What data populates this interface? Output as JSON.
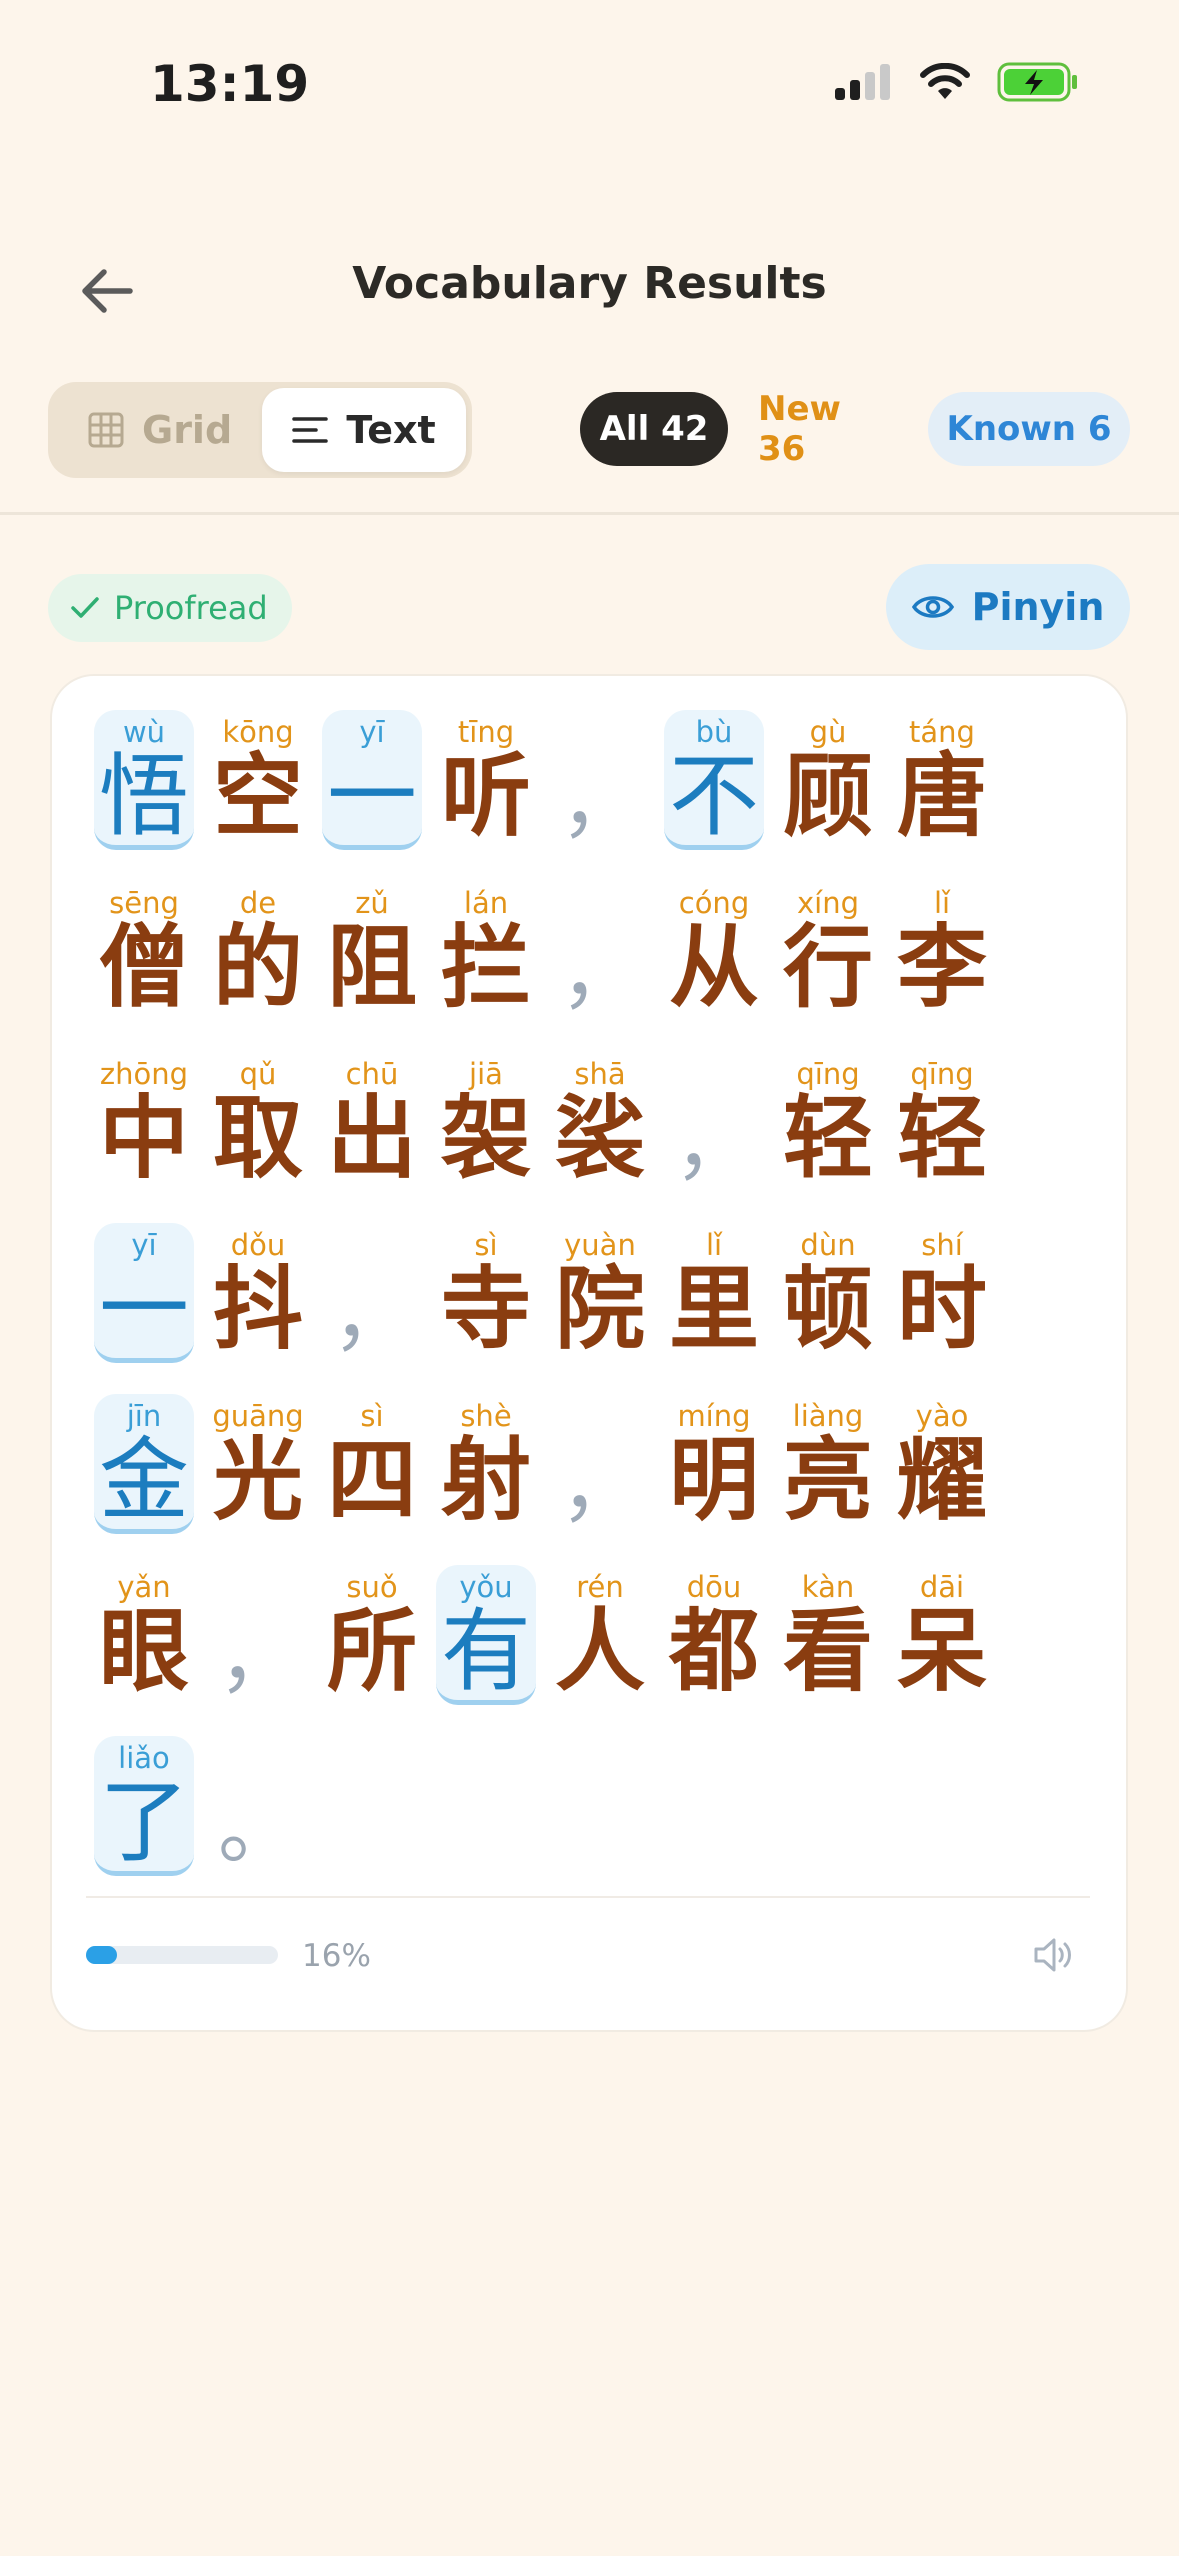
{
  "status": {
    "time": "13:19"
  },
  "header": {
    "title": "Vocabulary Results"
  },
  "view_toggle": {
    "grid_label": "Grid",
    "text_label": "Text",
    "selected": "Text"
  },
  "filters": {
    "all": "All 42",
    "new": "New 36",
    "known": "Known 6"
  },
  "badges": {
    "proofread": "Proofread",
    "pinyin": "Pinyin"
  },
  "colors": {
    "accent_blue": "#2ba0e6",
    "hanzi": "#8a3d10",
    "pinyin": "#e2941a",
    "known_bg": "#eaf5fc"
  },
  "text_rows": [
    [
      {
        "py": "wù",
        "hz": "悟",
        "known": true
      },
      {
        "py": "kōng",
        "hz": "空"
      },
      {
        "py": "yī",
        "hz": "一",
        "known": true
      },
      {
        "py": "tīng",
        "hz": "听"
      },
      {
        "p": "，"
      },
      {
        "py": "bù",
        "hz": "不",
        "known": true
      },
      {
        "py": "gù",
        "hz": "顾"
      },
      {
        "py": "táng",
        "hz": "唐"
      }
    ],
    [
      {
        "py": "sēng",
        "hz": "僧"
      },
      {
        "py": "de",
        "hz": "的"
      },
      {
        "py": "zǔ",
        "hz": "阻"
      },
      {
        "py": "lán",
        "hz": "拦"
      },
      {
        "p": "，"
      },
      {
        "py": "cóng",
        "hz": "从"
      },
      {
        "py": "xíng",
        "hz": "行"
      },
      {
        "py": "lǐ",
        "hz": "李"
      }
    ],
    [
      {
        "py": "zhōng",
        "hz": "中"
      },
      {
        "py": "qǔ",
        "hz": "取"
      },
      {
        "py": "chū",
        "hz": "出"
      },
      {
        "py": "jiā",
        "hz": "袈"
      },
      {
        "py": "shā",
        "hz": "裟"
      },
      {
        "p": "，"
      },
      {
        "py": "qīng",
        "hz": "轻"
      },
      {
        "py": "qīng",
        "hz": "轻"
      }
    ],
    [
      {
        "py": "yī",
        "hz": "一",
        "known": true
      },
      {
        "py": "dǒu",
        "hz": "抖"
      },
      {
        "p": "，"
      },
      {
        "py": "sì",
        "hz": "寺"
      },
      {
        "py": "yuàn",
        "hz": "院"
      },
      {
        "py": "lǐ",
        "hz": "里"
      },
      {
        "py": "dùn",
        "hz": "顿"
      },
      {
        "py": "shí",
        "hz": "时"
      }
    ],
    [
      {
        "py": "jīn",
        "hz": "金",
        "known": true
      },
      {
        "py": "guāng",
        "hz": "光"
      },
      {
        "py": "sì",
        "hz": "四"
      },
      {
        "py": "shè",
        "hz": "射"
      },
      {
        "p": "，"
      },
      {
        "py": "míng",
        "hz": "明"
      },
      {
        "py": "liàng",
        "hz": "亮"
      },
      {
        "py": "yào",
        "hz": "耀"
      }
    ],
    [
      {
        "py": "yǎn",
        "hz": "眼"
      },
      {
        "p": "，"
      },
      {
        "py": "suǒ",
        "hz": "所"
      },
      {
        "py": "yǒu",
        "hz": "有",
        "known": true
      },
      {
        "py": "rén",
        "hz": "人"
      },
      {
        "py": "dōu",
        "hz": "都"
      },
      {
        "py": "kàn",
        "hz": "看"
      },
      {
        "py": "dāi",
        "hz": "呆"
      }
    ],
    [
      {
        "py": "liǎo",
        "hz": "了",
        "known": true
      },
      {
        "p": "。"
      }
    ]
  ],
  "progress": {
    "value": 0.16,
    "label": "16%"
  }
}
